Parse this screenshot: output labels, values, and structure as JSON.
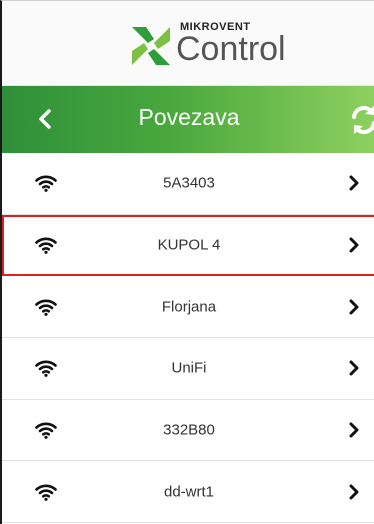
{
  "app": {
    "brand_small": "MIKROVENT",
    "brand_big": "Control"
  },
  "header": {
    "title": "Povezava",
    "back_icon": "chevron-left-icon",
    "refresh_icon": "refresh-icon"
  },
  "networks": [
    {
      "ssid": "5A3403",
      "selected": false
    },
    {
      "ssid": "KUPOL 4",
      "selected": true
    },
    {
      "ssid": "Florjana",
      "selected": false
    },
    {
      "ssid": "UniFi",
      "selected": false
    },
    {
      "ssid": "332B80",
      "selected": false
    },
    {
      "ssid": "dd-wrt1",
      "selected": false
    }
  ],
  "colors": {
    "header_start": "#2f8f3a",
    "header_end": "#8ed060",
    "selection": "#e02020"
  }
}
